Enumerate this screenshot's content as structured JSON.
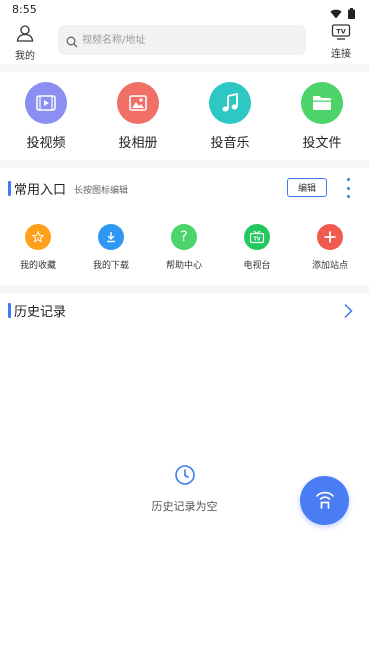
{
  "status_bar": {
    "time": "8:55",
    "icons": [
      "wifi-icon",
      "battery-icon"
    ]
  },
  "header": {
    "me_label": "我的",
    "search": {
      "placeholder": "视频名称/地址",
      "value": ""
    },
    "connect_label": "连接",
    "connect_icon_text": "TV"
  },
  "cast_actions": [
    {
      "label": "投视频",
      "icon": "video-icon",
      "color": "#8b8ff2"
    },
    {
      "label": "投相册",
      "icon": "photo-icon",
      "color": "#f07067"
    },
    {
      "label": "投音乐",
      "icon": "music-icon",
      "color": "#2ec8c4"
    },
    {
      "label": "投文件",
      "icon": "folder-icon",
      "color": "#4cd36a"
    }
  ],
  "shortcuts": {
    "title": "常用入口",
    "hint": "长按图标编辑",
    "edit_label": "编辑",
    "items": [
      {
        "label": "我的收藏",
        "icon": "star-icon",
        "color": "#ff9f1a"
      },
      {
        "label": "我的下载",
        "icon": "download-icon",
        "color": "#2f97f2"
      },
      {
        "label": "帮助中心",
        "icon": "help-icon",
        "color": "#4cd36a",
        "glyph": "?"
      },
      {
        "label": "电视台",
        "icon": "tv-icon",
        "color": "#22c75e",
        "glyph": "TV"
      },
      {
        "label": "添加站点",
        "icon": "plus-icon",
        "color": "#f25a4d",
        "glyph": "+"
      }
    ]
  },
  "history": {
    "title": "历史记录",
    "empty_text": "历史记录为空"
  },
  "colors": {
    "accent": "#3d7bef",
    "fab": "#4a7cf3"
  }
}
